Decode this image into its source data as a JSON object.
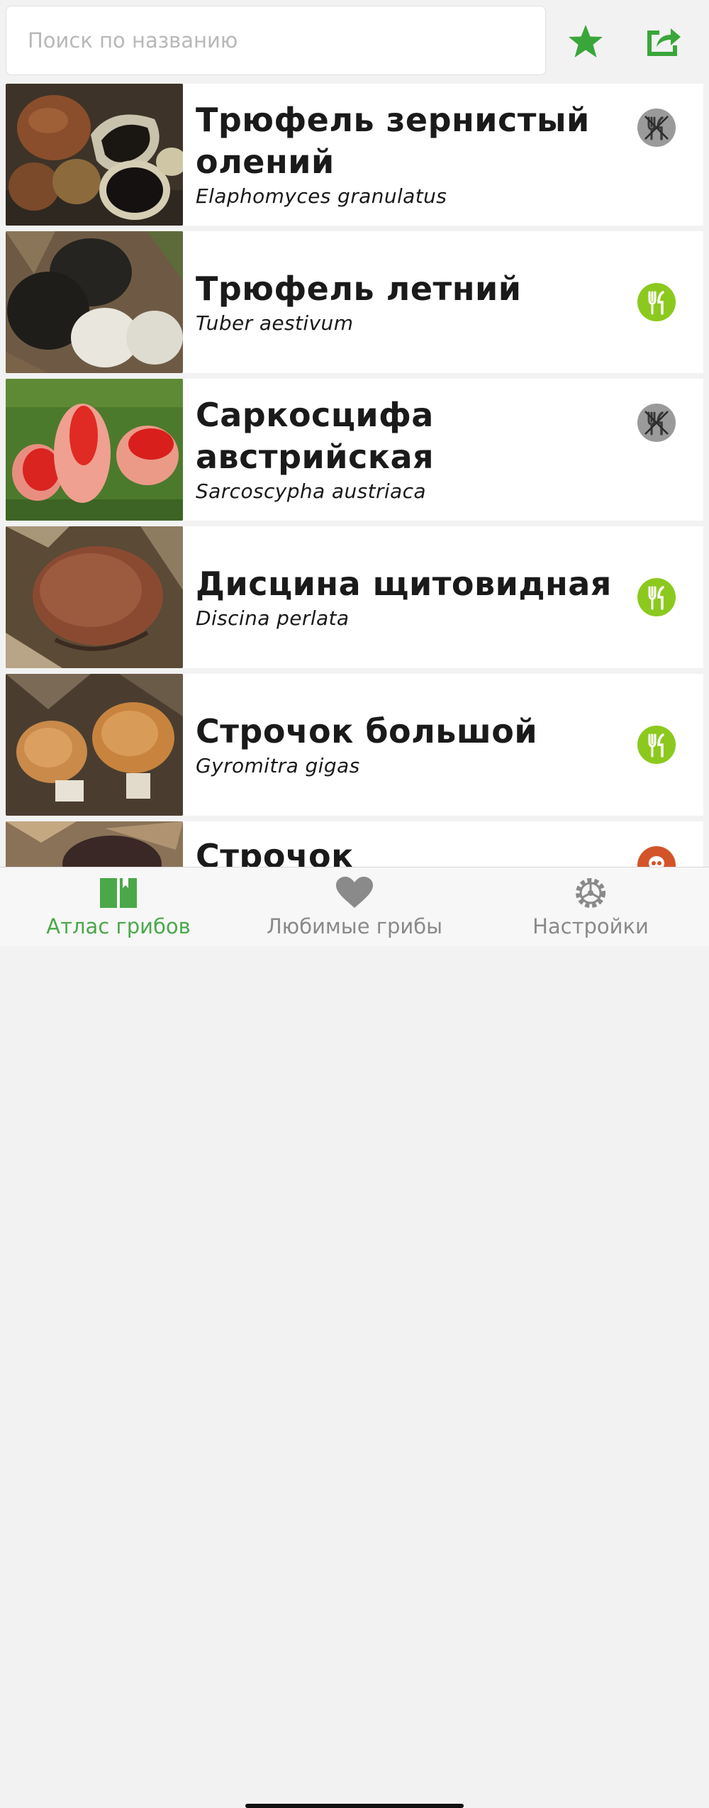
{
  "search": {
    "placeholder": "Поиск по названию"
  },
  "toolbar": {
    "favorites_icon": "star-icon",
    "share_icon": "share-icon",
    "accent": "#3aa63a"
  },
  "colors": {
    "edible": "#8cc91e",
    "inedible": "#9a9a9a",
    "poisonous": "#d4542a",
    "tab_active": "#4aa84a",
    "tab_inactive": "#8a8a8a"
  },
  "mushrooms": [
    {
      "name": "Трюфель зернистый олений",
      "latin": "Elaphomyces granulatus",
      "edibility": "inedible"
    },
    {
      "name": "Трюфель летний",
      "latin": "Tuber aestivum",
      "edibility": "edible"
    },
    {
      "name": "Саркосцифа австрийская",
      "latin": "Sarcoscypha austriaca",
      "edibility": "inedible"
    },
    {
      "name": "Дисцина щитовидная",
      "latin": "Discina perlata",
      "edibility": "edible"
    },
    {
      "name": "Строчок большой",
      "latin": "Gyromitra gigas",
      "edibility": "edible"
    },
    {
      "name": "Строчок",
      "latin": "",
      "edibility": "poisonous"
    }
  ],
  "tabs": [
    {
      "label": "Атлас грибов",
      "icon": "book-icon",
      "active": true
    },
    {
      "label": "Любимые грибы",
      "icon": "heart-icon",
      "active": false
    },
    {
      "label": "Настройки",
      "icon": "gear-icon",
      "active": false
    }
  ]
}
